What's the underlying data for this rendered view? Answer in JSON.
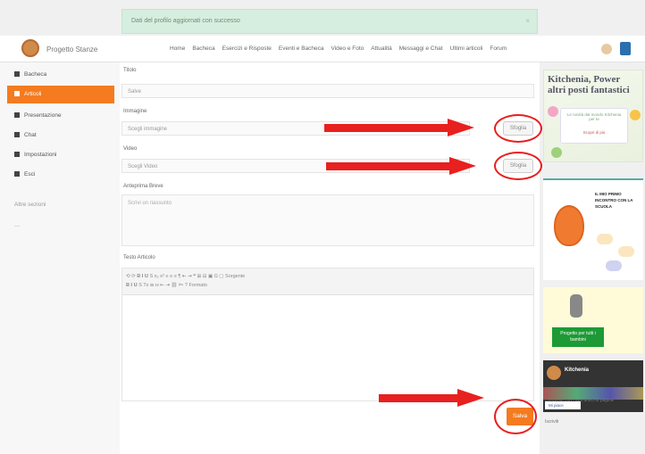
{
  "alert": {
    "message": "Dati del profilo aggiornati con successo",
    "close": "×"
  },
  "header": {
    "brand": "Progetto Stanze",
    "nav": [
      "Home",
      "Bacheca",
      "Esercizi e Risposte",
      "Eventi e Bacheca",
      "Video e Foto",
      "Attualità",
      "Messaggi e Chat",
      "Ultimi articoli",
      "Forum"
    ]
  },
  "sidebar": {
    "items": [
      "Bacheca",
      "Articoli",
      "Presentazione",
      "Chat",
      "Impostazioni",
      "Esci"
    ],
    "extra": "Altre sezioni",
    "extra2": "—"
  },
  "form": {
    "title_label": "Titolo",
    "title_value": "Salve",
    "image_label": "Immagine",
    "image_value": "Scegli immagine",
    "video_label": "Video",
    "video_value": "Scegli Video",
    "browse": "Sfoglia",
    "short_label": "Anteprima Breve",
    "short_placeholder": "Scrivi un riassunto",
    "body_label": "Testo Articolo",
    "toolbar_row1": "⟲ ⟳ 𝐁 𝐈 𝐔  S  x₂ x²  ≡ ≡ ≡  ¶  ⇤ ⇥  ❝  ⊞ ⊟ ▣  Ω  ▢ Sorgente",
    "toolbar_row2": "𝐁 𝐈 𝐔 S  Tx  ☰ ☷  ⇤ ⇥  ⛓ ✂  ?  Formato",
    "save": "Salva"
  },
  "ads": {
    "ad1_title": "Kitchenia, Power altri posti fantastici",
    "ad1_body": "Le novità dal mondo Kitchenia per te",
    "ad1_footer": "Scopri di più",
    "ad2_text": "IL MIO PRIMO INCONTRO CON LA SCUOLA",
    "ad3_button": "Progetto per tutti i bambini",
    "ad4_title": "Kitchenia",
    "ad4_like": "Mi piace",
    "footer1": "Condividi con i tuoi amici la pagina",
    "footer2": "Iscriviti"
  },
  "colors": {
    "accent": "#f47b20",
    "annotation": "#e8201f",
    "alert_bg": "#d6eedf"
  }
}
